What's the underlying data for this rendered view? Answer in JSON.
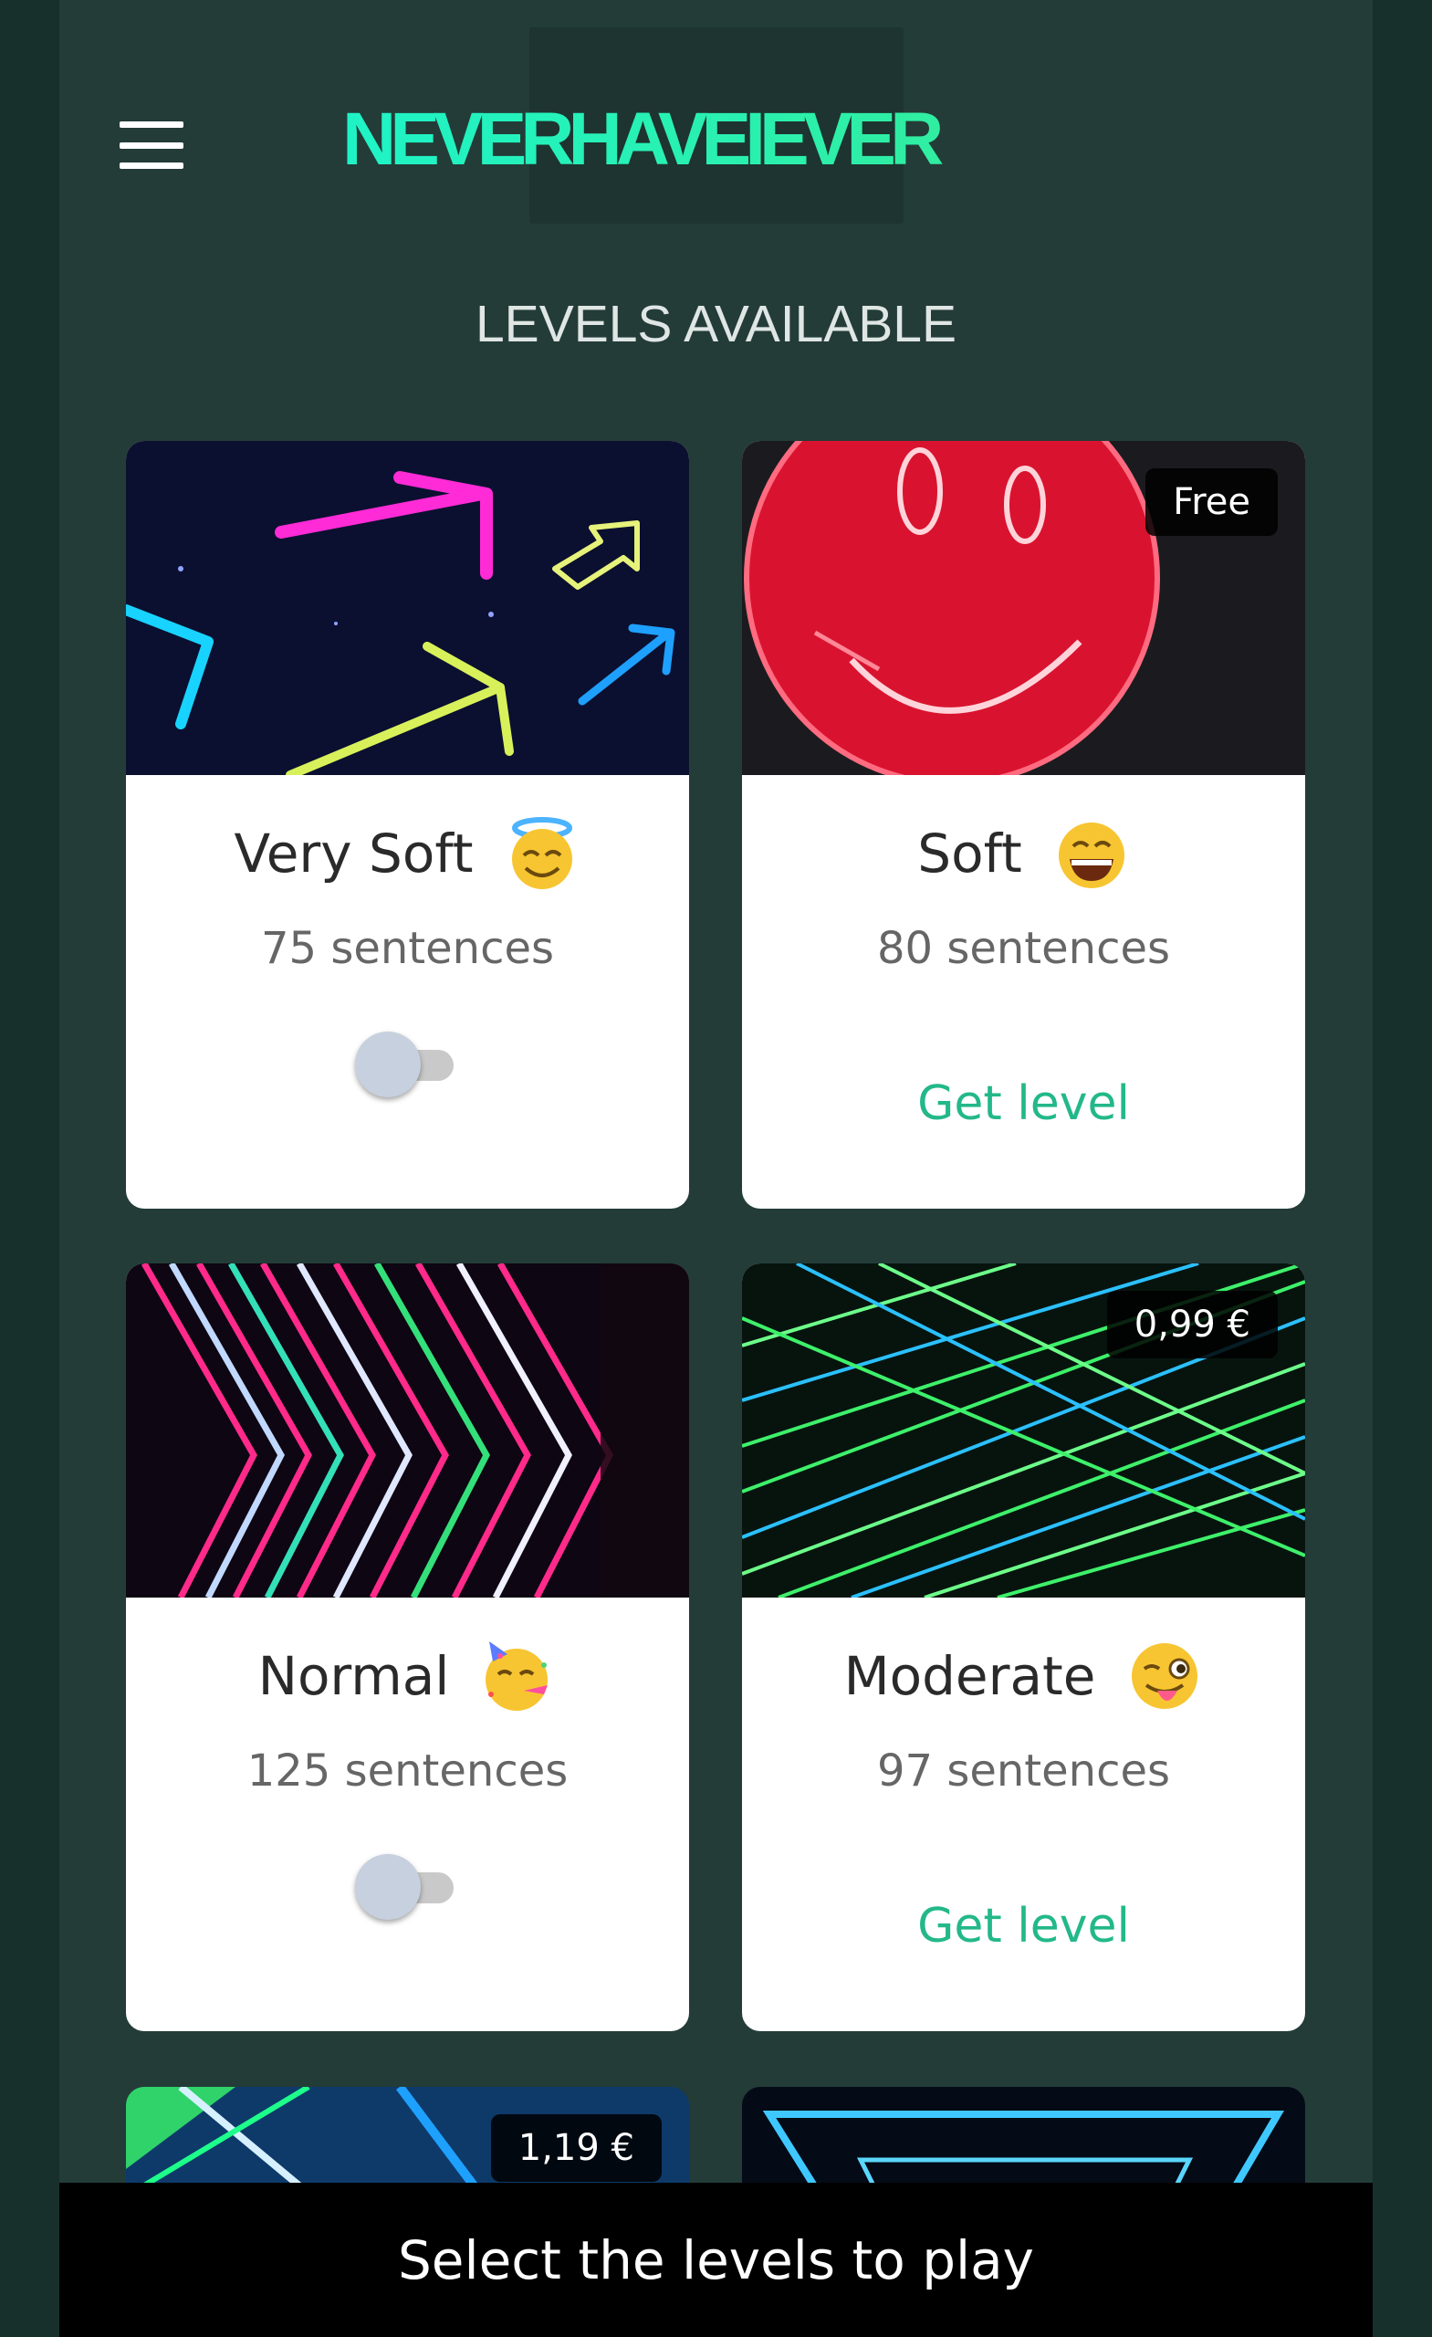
{
  "app": {
    "logo_text": "NEVERHAVEIEVER",
    "menu_icon": "hamburger-menu-icon"
  },
  "section_title": "LEVELS AVAILABLE",
  "levels": [
    {
      "name": "Very Soft",
      "emoji": "smiling-face-with-halo-emoji",
      "sentences": "75 sentences",
      "state": "toggle",
      "toggle_on": false,
      "image_theme": "neon arrows"
    },
    {
      "name": "Soft",
      "emoji": "grinning-face-with-smiling-eyes-emoji",
      "sentences": "80 sentences",
      "state": "locked",
      "badge": "Free",
      "action_label": "Get level",
      "image_theme": "red neon smiley face"
    },
    {
      "name": "Normal",
      "emoji": "partying-face-emoji",
      "sentences": "125 sentences",
      "state": "toggle",
      "toggle_on": false,
      "image_theme": "neon chevron stripes"
    },
    {
      "name": "Moderate",
      "emoji": "winking-face-with-tongue-emoji",
      "sentences": "97 sentences",
      "state": "locked",
      "badge": "0,99 €",
      "action_label": "Get level",
      "image_theme": "green laser lines"
    }
  ],
  "partial_levels": [
    {
      "badge": "1,19 €"
    },
    {
      "badge": ""
    }
  ],
  "footer": {
    "label": "Select the levels to play"
  },
  "colors": {
    "background": "#233c38",
    "accent": "#23b889",
    "logo_gradient_start": "#1ff3c6",
    "logo_gradient_end": "#38e98e",
    "footer_bg": "#000000"
  }
}
